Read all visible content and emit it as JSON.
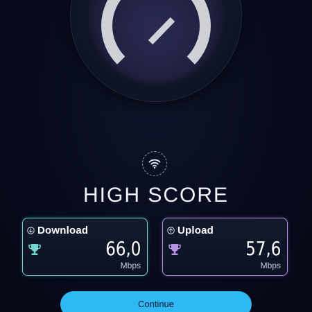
{
  "screen": {
    "title": "HIGH SCORE"
  },
  "gauge": {
    "icon": "speedometer-icon"
  },
  "wifi": {
    "icon": "wifi-icon"
  },
  "download": {
    "label": "Download",
    "value": "66,0",
    "unit": "Mbps",
    "accent": "#74d6d0",
    "icon": "arrow-down-circle-icon",
    "trophy_icon": "trophy-icon"
  },
  "upload": {
    "label": "Upload",
    "value": "57,6",
    "unit": "Mbps",
    "accent": "#b793e6",
    "icon": "arrow-up-circle-icon",
    "trophy_icon": "trophy-icon"
  },
  "continue_button": {
    "label": "Continue",
    "color": "#2fb8f3"
  }
}
